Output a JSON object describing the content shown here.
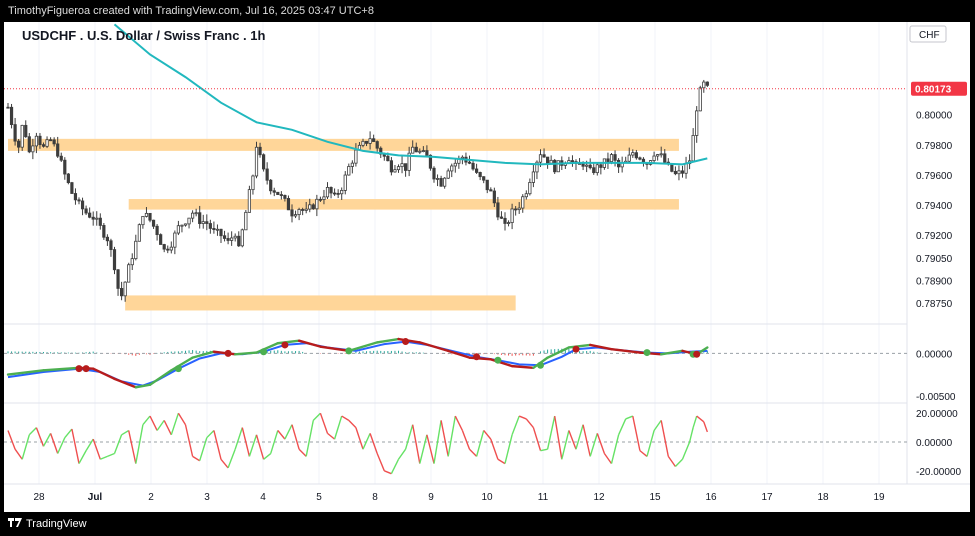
{
  "header": {
    "created_by": "TimothyFigueroa created with TradingView.com, Jul 16, 2025 03:47 UTC+8",
    "symbol_title": "USDCHF . U.S. Dollar / Swiss Franc . 1h",
    "currency": "CHF"
  },
  "footer": {
    "brand": "TradingView"
  },
  "colors": {
    "candle": "#3d3d3d",
    "ma": "#21b8be",
    "zone": "#ffd699",
    "price_badge": "#f23645",
    "macd_up": "#4caf50",
    "macd_dn": "#b71c1c",
    "signal": "#2962ff",
    "osc_up": "#66e266",
    "osc_dn": "#ef4f4f"
  },
  "chart_data": [
    {
      "type": "candlestick",
      "title": "USDCHF . U.S. Dollar / Swiss Franc . 1h",
      "ylim": [
        0.7865,
        0.8043
      ],
      "y_ticks": [
        "0.80000",
        "0.79800",
        "0.79600",
        "0.79400",
        "0.79200",
        "0.79050",
        "0.78900",
        "0.78750"
      ],
      "last_price": "0.80173",
      "x_ticks": [
        "28",
        "Jul",
        "2",
        "3",
        "4",
        "5",
        "8",
        "9",
        "10",
        "11",
        "12",
        "15",
        "16",
        "17",
        "18",
        "19"
      ],
      "close_path": [
        [
          0,
          0.8005
        ],
        [
          1,
          0.7995
        ],
        [
          2,
          0.7985
        ],
        [
          3,
          0.7979
        ],
        [
          4,
          0.7992
        ],
        [
          5,
          0.7987
        ],
        [
          6,
          0.7975
        ],
        [
          7,
          0.7982
        ],
        [
          8,
          0.7988
        ],
        [
          9,
          0.7982
        ],
        [
          10,
          0.7978
        ],
        [
          12,
          0.7983
        ],
        [
          14,
          0.7975
        ],
        [
          16,
          0.796
        ],
        [
          18,
          0.7948
        ],
        [
          20,
          0.794
        ],
        [
          22,
          0.7935
        ],
        [
          24,
          0.7932
        ],
        [
          26,
          0.7925
        ],
        [
          28,
          0.7918
        ],
        [
          30,
          0.79
        ],
        [
          31,
          0.7885
        ],
        [
          32,
          0.788
        ],
        [
          34,
          0.7898
        ],
        [
          36,
          0.7915
        ],
        [
          38,
          0.7935
        ],
        [
          40,
          0.793
        ],
        [
          42,
          0.7922
        ],
        [
          44,
          0.791
        ],
        [
          46,
          0.7915
        ],
        [
          48,
          0.7925
        ],
        [
          50,
          0.793
        ],
        [
          52,
          0.7935
        ],
        [
          54,
          0.793
        ],
        [
          56,
          0.7928
        ],
        [
          58,
          0.7922
        ],
        [
          60,
          0.792
        ],
        [
          62,
          0.7915
        ],
        [
          64,
          0.7922
        ],
        [
          65,
          0.791
        ],
        [
          67,
          0.7935
        ],
        [
          69,
          0.796
        ],
        [
          70,
          0.798
        ],
        [
          72,
          0.7962
        ],
        [
          74,
          0.7952
        ],
        [
          76,
          0.7948
        ],
        [
          78,
          0.7942
        ],
        [
          80,
          0.7935
        ],
        [
          82,
          0.7938
        ],
        [
          84,
          0.7935
        ],
        [
          86,
          0.794
        ],
        [
          88,
          0.7945
        ],
        [
          90,
          0.795
        ],
        [
          92,
          0.7945
        ],
        [
          94,
          0.7952
        ],
        [
          96,
          0.7965
        ],
        [
          98,
          0.7975
        ],
        [
          100,
          0.798
        ],
        [
          102,
          0.7985
        ],
        [
          104,
          0.7978
        ],
        [
          106,
          0.7972
        ],
        [
          108,
          0.7965
        ],
        [
          110,
          0.7968
        ],
        [
          112,
          0.7965
        ],
        [
          114,
          0.7978
        ],
        [
          116,
          0.7975
        ],
        [
          118,
          0.7972
        ],
        [
          120,
          0.796
        ],
        [
          122,
          0.7955
        ],
        [
          124,
          0.7965
        ],
        [
          126,
          0.7968
        ],
        [
          128,
          0.7972
        ],
        [
          130,
          0.7968
        ],
        [
          132,
          0.796
        ],
        [
          134,
          0.7955
        ],
        [
          136,
          0.7948
        ],
        [
          138,
          0.7935
        ],
        [
          140,
          0.7925
        ],
        [
          142,
          0.7935
        ],
        [
          144,
          0.794
        ],
        [
          146,
          0.795
        ],
        [
          148,
          0.7965
        ],
        [
          150,
          0.7975
        ],
        [
          152,
          0.797
        ],
        [
          154,
          0.7965
        ],
        [
          156,
          0.7968
        ],
        [
          158,
          0.7972
        ],
        [
          160,
          0.7965
        ],
        [
          162,
          0.7968
        ],
        [
          164,
          0.7962
        ],
        [
          166,
          0.7965
        ],
        [
          168,
          0.7968
        ],
        [
          170,
          0.7972
        ],
        [
          172,
          0.7965
        ],
        [
          174,
          0.7968
        ],
        [
          176,
          0.7975
        ],
        [
          178,
          0.7972
        ],
        [
          180,
          0.7968
        ],
        [
          182,
          0.7975
        ],
        [
          184,
          0.7972
        ],
        [
          186,
          0.7965
        ],
        [
          188,
          0.796
        ],
        [
          190,
          0.7962
        ],
        [
          192,
          0.797
        ],
        [
          193,
          0.7985
        ],
        [
          194,
          0.8005
        ],
        [
          195,
          0.8015
        ],
        [
          196,
          0.802
        ],
        [
          197,
          0.8017
        ]
      ],
      "ma_path": [
        [
          30,
          0.806
        ],
        [
          40,
          0.804
        ],
        [
          50,
          0.8025
        ],
        [
          60,
          0.8008
        ],
        [
          70,
          0.7995
        ],
        [
          80,
          0.799
        ],
        [
          90,
          0.7982
        ],
        [
          100,
          0.7976
        ],
        [
          110,
          0.7973
        ],
        [
          120,
          0.7972
        ],
        [
          130,
          0.797
        ],
        [
          140,
          0.7968
        ],
        [
          150,
          0.7967
        ],
        [
          160,
          0.7968
        ],
        [
          170,
          0.7968
        ],
        [
          180,
          0.7968
        ],
        [
          190,
          0.7967
        ],
        [
          197,
          0.7971
        ]
      ],
      "zones": [
        {
          "from": 0,
          "to": 189,
          "low": 0.7976,
          "high": 0.7984
        },
        {
          "from": 34,
          "to": 189,
          "low": 0.7937,
          "high": 0.7944
        },
        {
          "from": 33,
          "to": 143,
          "low": 0.787,
          "high": 0.788
        }
      ]
    },
    {
      "type": "line",
      "ylim": [
        -0.0055,
        0.003
      ],
      "y_ticks": [
        "0.00000",
        "-0.00500"
      ],
      "macd": [
        [
          0,
          -0.0025
        ],
        [
          10,
          -0.002
        ],
        [
          20,
          -0.0017
        ],
        [
          24,
          -0.0018
        ],
        [
          30,
          -0.003
        ],
        [
          36,
          -0.004
        ],
        [
          40,
          -0.0037
        ],
        [
          46,
          -0.002
        ],
        [
          52,
          -0.0005
        ],
        [
          58,
          0.0002
        ],
        [
          64,
          -0.0001
        ],
        [
          70,
          0.0001
        ],
        [
          76,
          0.0012
        ],
        [
          82,
          0.0015
        ],
        [
          88,
          0.0008
        ],
        [
          96,
          0.0003
        ],
        [
          104,
          0.0013
        ],
        [
          110,
          0.0017
        ],
        [
          116,
          0.0013
        ],
        [
          124,
          0.0003
        ],
        [
          130,
          -0.0005
        ],
        [
          136,
          -0.0007
        ],
        [
          142,
          -0.0015
        ],
        [
          148,
          -0.0017
        ],
        [
          152,
          -0.0005
        ],
        [
          158,
          0.0007
        ],
        [
          164,
          0.001
        ],
        [
          170,
          0.0005
        ],
        [
          178,
          0.0001
        ],
        [
          184,
          -0.0001
        ],
        [
          190,
          0.0003
        ],
        [
          194,
          -0.0001
        ],
        [
          197,
          0.0007
        ]
      ],
      "signal": [
        [
          0,
          -0.0028
        ],
        [
          10,
          -0.0022
        ],
        [
          20,
          -0.0018
        ],
        [
          26,
          -0.0022
        ],
        [
          32,
          -0.0033
        ],
        [
          38,
          -0.0038
        ],
        [
          42,
          -0.0032
        ],
        [
          48,
          -0.0018
        ],
        [
          54,
          -0.0006
        ],
        [
          60,
          0.0
        ],
        [
          66,
          -0.0001
        ],
        [
          72,
          0.0002
        ],
        [
          78,
          0.001
        ],
        [
          84,
          0.0012
        ],
        [
          90,
          0.0007
        ],
        [
          98,
          0.0003
        ],
        [
          106,
          0.0011
        ],
        [
          112,
          0.0014
        ],
        [
          118,
          0.001
        ],
        [
          126,
          0.0002
        ],
        [
          132,
          -0.0004
        ],
        [
          138,
          -0.0008
        ],
        [
          144,
          -0.0013
        ],
        [
          150,
          -0.0014
        ],
        [
          156,
          -0.0004
        ],
        [
          160,
          0.0005
        ],
        [
          166,
          0.0007
        ],
        [
          172,
          0.0004
        ],
        [
          180,
          0.0001
        ],
        [
          186,
          0.0
        ],
        [
          192,
          0.0002
        ],
        [
          197,
          0.0003
        ]
      ],
      "cross_up": [
        [
          48,
          -0.0018
        ],
        [
          72,
          0.0002
        ],
        [
          96,
          0.0003
        ],
        [
          138,
          -0.0008
        ],
        [
          150,
          -0.0014
        ],
        [
          180,
          0.0001
        ],
        [
          193,
          -0.0001
        ]
      ],
      "cross_dn": [
        [
          20,
          -0.0018
        ],
        [
          22,
          -0.0018
        ],
        [
          62,
          0.0
        ],
        [
          78,
          0.001
        ],
        [
          112,
          0.0014
        ],
        [
          132,
          -0.0004
        ],
        [
          160,
          0.0005
        ],
        [
          194,
          -0.0001
        ]
      ]
    },
    {
      "type": "line",
      "ylim": [
        -25,
        25
      ],
      "y_ticks": [
        "20.00000",
        "0.00000",
        "-20.00000"
      ],
      "values": [
        [
          0,
          8
        ],
        [
          2,
          -5
        ],
        [
          4,
          -12
        ],
        [
          6,
          5
        ],
        [
          8,
          10
        ],
        [
          10,
          -3
        ],
        [
          12,
          6
        ],
        [
          14,
          -8
        ],
        [
          16,
          3
        ],
        [
          18,
          9
        ],
        [
          20,
          -15
        ],
        [
          22,
          -6
        ],
        [
          24,
          2
        ],
        [
          26,
          -12
        ],
        [
          28,
          -10
        ],
        [
          30,
          -8
        ],
        [
          32,
          5
        ],
        [
          34,
          8
        ],
        [
          36,
          -15
        ],
        [
          38,
          12
        ],
        [
          40,
          18
        ],
        [
          42,
          8
        ],
        [
          44,
          15
        ],
        [
          46,
          5
        ],
        [
          48,
          20
        ],
        [
          50,
          12
        ],
        [
          52,
          -10
        ],
        [
          54,
          -13
        ],
        [
          56,
          3
        ],
        [
          58,
          8
        ],
        [
          60,
          -12
        ],
        [
          62,
          -18
        ],
        [
          64,
          -5
        ],
        [
          66,
          10
        ],
        [
          68,
          -10
        ],
        [
          70,
          5
        ],
        [
          72,
          -12
        ],
        [
          74,
          -8
        ],
        [
          76,
          8
        ],
        [
          78,
          2
        ],
        [
          80,
          12
        ],
        [
          82,
          -5
        ],
        [
          84,
          -10
        ],
        [
          86,
          15
        ],
        [
          88,
          20
        ],
        [
          90,
          6
        ],
        [
          92,
          2
        ],
        [
          94,
          18
        ],
        [
          96,
          15
        ],
        [
          98,
          10
        ],
        [
          100,
          -5
        ],
        [
          102,
          6
        ],
        [
          104,
          -8
        ],
        [
          106,
          -20
        ],
        [
          108,
          -22
        ],
        [
          110,
          -12
        ],
        [
          112,
          -5
        ],
        [
          114,
          12
        ],
        [
          116,
          -15
        ],
        [
          118,
          5
        ],
        [
          120,
          -15
        ],
        [
          122,
          15
        ],
        [
          124,
          -10
        ],
        [
          126,
          18
        ],
        [
          128,
          8
        ],
        [
          130,
          -5
        ],
        [
          132,
          -10
        ],
        [
          134,
          8
        ],
        [
          136,
          2
        ],
        [
          138,
          -12
        ],
        [
          140,
          -15
        ],
        [
          142,
          5
        ],
        [
          144,
          18
        ],
        [
          146,
          16
        ],
        [
          148,
          10
        ],
        [
          150,
          -6
        ],
        [
          152,
          -5
        ],
        [
          154,
          18
        ],
        [
          156,
          -12
        ],
        [
          158,
          8
        ],
        [
          160,
          -5
        ],
        [
          162,
          12
        ],
        [
          164,
          -10
        ],
        [
          166,
          6
        ],
        [
          168,
          -8
        ],
        [
          170,
          -15
        ],
        [
          172,
          5
        ],
        [
          174,
          16
        ],
        [
          176,
          18
        ],
        [
          178,
          -6
        ],
        [
          180,
          -10
        ],
        [
          182,
          8
        ],
        [
          184,
          15
        ],
        [
          186,
          -10
        ],
        [
          188,
          -17
        ],
        [
          190,
          -12
        ],
        [
          192,
          0
        ],
        [
          193,
          10
        ],
        [
          194,
          18
        ],
        [
          196,
          14
        ],
        [
          197,
          7
        ]
      ]
    }
  ]
}
